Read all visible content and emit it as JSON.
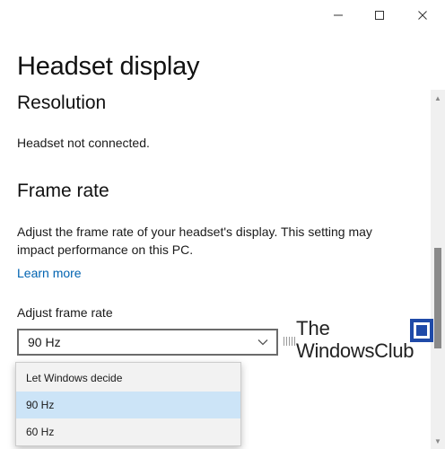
{
  "window": {
    "controls": {
      "minimize_icon": "minimize-icon",
      "maximize_icon": "maximize-icon",
      "close_icon": "close-icon"
    }
  },
  "page": {
    "title": "Headset display"
  },
  "resolution": {
    "heading": "Resolution",
    "status": "Headset not connected."
  },
  "frame_rate": {
    "heading": "Frame rate",
    "description": "Adjust the frame rate of your headset's display. This setting may impact performance on this PC.",
    "learn_more": "Learn more",
    "combo_label": "Adjust frame rate",
    "selected": "90 Hz",
    "options": [
      "Let Windows decide",
      "90 Hz",
      "60 Hz"
    ]
  },
  "watermark": {
    "line1": "The",
    "line2": "WindowsClub"
  },
  "colors": {
    "accent_link": "#0063b1",
    "selected_option": "#cce4f7",
    "dropdown_bg": "#f2f2f2"
  }
}
